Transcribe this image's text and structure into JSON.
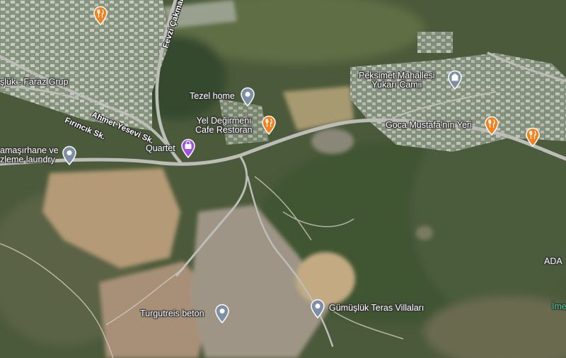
{
  "colors": {
    "food_pin": "#f2811d",
    "place_pin": "#7c8fa3",
    "shopping_pin": "#a152e0",
    "road": "#bdbdb8",
    "label_text": "#ffffff"
  },
  "roads": {
    "cakmak": "Fevzi Çakmak Cd.",
    "ahmet_yesevi": "Ahmet Yesevi Sk.",
    "firincik": "Fırıncık Sk."
  },
  "places": {
    "faraz": "şlük - Faraz Grup",
    "tezel": "Tezel home",
    "yel_line1": "Yel Değirmeni",
    "yel_line2": "Cafe Restoran",
    "peksimet_line1": "Peksimet Mahallesi",
    "peksimet_line2": "Yukarı Camii",
    "goca": "Goca Mustafa'nın Yeri",
    "quartet": "Quartet",
    "camasir_line1": "amaşırhane ve",
    "camasir_line2": "zleme laundry",
    "turgutreis": "Turgutreis beton",
    "gumusluk": "Gümüşlük Teras Villaları",
    "ada": "ADA",
    "ime": "İme"
  },
  "icons": {
    "food": "fork-knife-icon",
    "place": "map-pin-icon",
    "mosque": "mosque-icon",
    "shopping": "shopping-bag-icon"
  }
}
